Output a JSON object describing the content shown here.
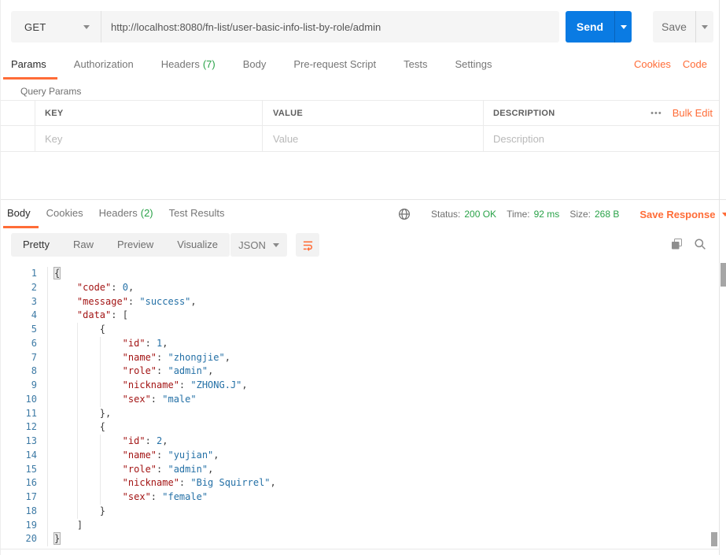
{
  "request": {
    "method": "GET",
    "url": "http://localhost:8080/fn-list/user-basic-info-list-by-role/admin",
    "send_label": "Send",
    "save_label": "Save",
    "tabs": [
      {
        "label": "Params",
        "active": true
      },
      {
        "label": "Authorization"
      },
      {
        "label": "Headers",
        "count": "(7)"
      },
      {
        "label": "Body"
      },
      {
        "label": "Pre-request Script"
      },
      {
        "label": "Tests"
      },
      {
        "label": "Settings"
      }
    ],
    "links": {
      "cookies": "Cookies",
      "code": "Code"
    },
    "query_params": {
      "title": "Query Params",
      "columns": [
        "KEY",
        "VALUE",
        "DESCRIPTION"
      ],
      "placeholders": {
        "key": "Key",
        "value": "Value",
        "description": "Description"
      },
      "more": "•••",
      "bulk_edit": "Bulk Edit"
    }
  },
  "response": {
    "tabs": [
      {
        "label": "Body",
        "active": true
      },
      {
        "label": "Cookies"
      },
      {
        "label": "Headers",
        "count": "(2)"
      },
      {
        "label": "Test Results"
      }
    ],
    "meta": {
      "status_label": "Status:",
      "status_value": "200 OK",
      "time_label": "Time:",
      "time_value": "92 ms",
      "size_label": "Size:",
      "size_value": "268 B",
      "save_response_label": "Save Response"
    },
    "views": [
      "Pretty",
      "Raw",
      "Preview",
      "Visualize"
    ],
    "active_view": "Pretty",
    "format": "JSON",
    "code": {
      "lines": [
        {
          "n": 1,
          "indent": 0,
          "tokens": [
            {
              "c": "hl",
              "t": "{"
            }
          ]
        },
        {
          "n": 2,
          "indent": 1,
          "tokens": [
            {
              "c": "k",
              "t": "\"code\""
            },
            {
              "c": "p",
              "t": ": "
            },
            {
              "c": "v",
              "t": "0"
            },
            {
              "c": "p",
              "t": ","
            }
          ]
        },
        {
          "n": 3,
          "indent": 1,
          "tokens": [
            {
              "c": "k",
              "t": "\"message\""
            },
            {
              "c": "p",
              "t": ": "
            },
            {
              "c": "v",
              "t": "\"success\""
            },
            {
              "c": "p",
              "t": ","
            }
          ]
        },
        {
          "n": 4,
          "indent": 1,
          "tokens": [
            {
              "c": "k",
              "t": "\"data\""
            },
            {
              "c": "p",
              "t": ": ["
            }
          ]
        },
        {
          "n": 5,
          "indent": 2,
          "tokens": [
            {
              "c": "p",
              "t": "{"
            }
          ]
        },
        {
          "n": 6,
          "indent": 3,
          "tokens": [
            {
              "c": "k",
              "t": "\"id\""
            },
            {
              "c": "p",
              "t": ": "
            },
            {
              "c": "v",
              "t": "1"
            },
            {
              "c": "p",
              "t": ","
            }
          ]
        },
        {
          "n": 7,
          "indent": 3,
          "tokens": [
            {
              "c": "k",
              "t": "\"name\""
            },
            {
              "c": "p",
              "t": ": "
            },
            {
              "c": "v",
              "t": "\"zhongjie\""
            },
            {
              "c": "p",
              "t": ","
            }
          ]
        },
        {
          "n": 8,
          "indent": 3,
          "tokens": [
            {
              "c": "k",
              "t": "\"role\""
            },
            {
              "c": "p",
              "t": ": "
            },
            {
              "c": "v",
              "t": "\"admin\""
            },
            {
              "c": "p",
              "t": ","
            }
          ]
        },
        {
          "n": 9,
          "indent": 3,
          "tokens": [
            {
              "c": "k",
              "t": "\"nickname\""
            },
            {
              "c": "p",
              "t": ": "
            },
            {
              "c": "v",
              "t": "\"ZHONG.J\""
            },
            {
              "c": "p",
              "t": ","
            }
          ]
        },
        {
          "n": 10,
          "indent": 3,
          "tokens": [
            {
              "c": "k",
              "t": "\"sex\""
            },
            {
              "c": "p",
              "t": ": "
            },
            {
              "c": "v",
              "t": "\"male\""
            }
          ]
        },
        {
          "n": 11,
          "indent": 2,
          "tokens": [
            {
              "c": "p",
              "t": "},"
            }
          ]
        },
        {
          "n": 12,
          "indent": 2,
          "tokens": [
            {
              "c": "p",
              "t": "{"
            }
          ]
        },
        {
          "n": 13,
          "indent": 3,
          "tokens": [
            {
              "c": "k",
              "t": "\"id\""
            },
            {
              "c": "p",
              "t": ": "
            },
            {
              "c": "v",
              "t": "2"
            },
            {
              "c": "p",
              "t": ","
            }
          ]
        },
        {
          "n": 14,
          "indent": 3,
          "tokens": [
            {
              "c": "k",
              "t": "\"name\""
            },
            {
              "c": "p",
              "t": ": "
            },
            {
              "c": "v",
              "t": "\"yujian\""
            },
            {
              "c": "p",
              "t": ","
            }
          ]
        },
        {
          "n": 15,
          "indent": 3,
          "tokens": [
            {
              "c": "k",
              "t": "\"role\""
            },
            {
              "c": "p",
              "t": ": "
            },
            {
              "c": "v",
              "t": "\"admin\""
            },
            {
              "c": "p",
              "t": ","
            }
          ]
        },
        {
          "n": 16,
          "indent": 3,
          "tokens": [
            {
              "c": "k",
              "t": "\"nickname\""
            },
            {
              "c": "p",
              "t": ": "
            },
            {
              "c": "v",
              "t": "\"Big Squirrel\""
            },
            {
              "c": "p",
              "t": ","
            }
          ]
        },
        {
          "n": 17,
          "indent": 3,
          "tokens": [
            {
              "c": "k",
              "t": "\"sex\""
            },
            {
              "c": "p",
              "t": ": "
            },
            {
              "c": "v",
              "t": "\"female\""
            }
          ]
        },
        {
          "n": 18,
          "indent": 2,
          "tokens": [
            {
              "c": "p",
              "t": "}"
            }
          ]
        },
        {
          "n": 19,
          "indent": 1,
          "tokens": [
            {
              "c": "p",
              "t": "]"
            }
          ]
        },
        {
          "n": 20,
          "indent": 0,
          "tokens": [
            {
              "c": "hl",
              "t": "}"
            }
          ]
        }
      ]
    }
  },
  "colors": {
    "accent_orange": "#ff6c37",
    "send_blue": "#0a7be3",
    "success_green": "#29a248",
    "json_key_red": "#a31515",
    "json_value_blue": "#2470a6",
    "line_number_blue": "#3d7aa5"
  }
}
